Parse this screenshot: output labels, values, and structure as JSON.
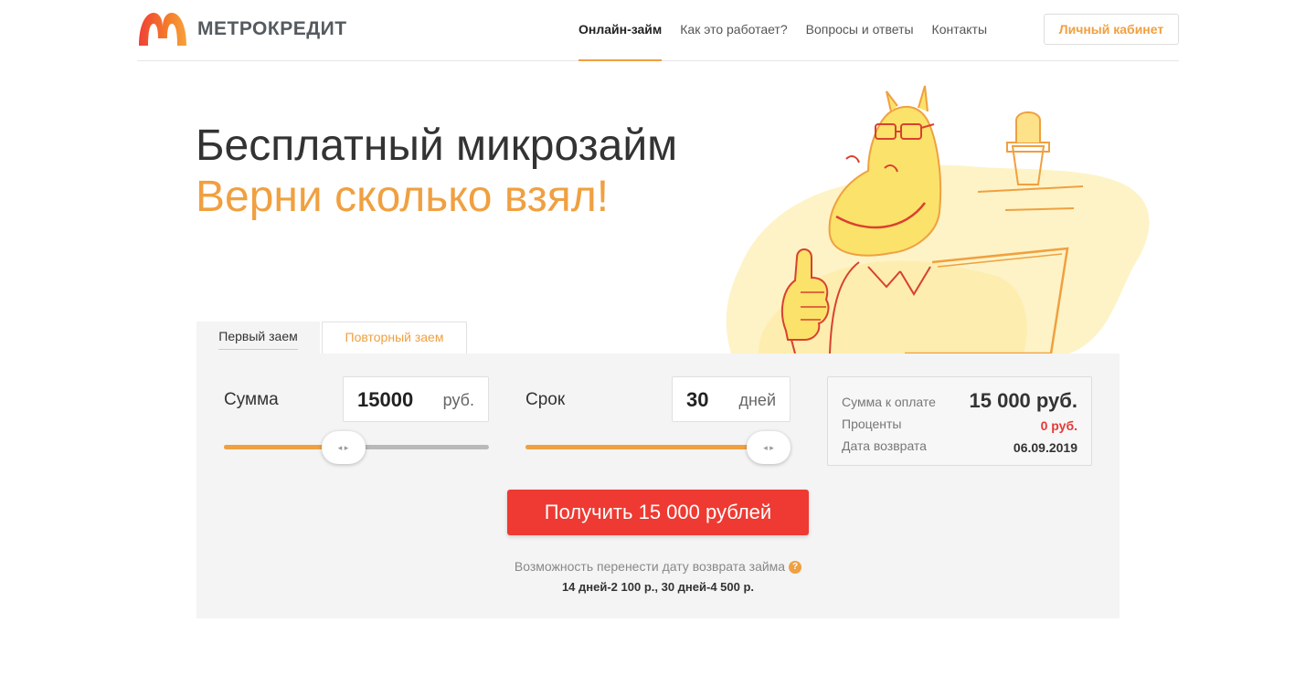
{
  "header": {
    "logo_text": "МЕТРОКРЕДИТ",
    "nav": [
      {
        "label": "Онлайн-займ",
        "active": true
      },
      {
        "label": "Как это работает?",
        "active": false
      },
      {
        "label": "Вопросы и ответы",
        "active": false
      },
      {
        "label": "Контакты",
        "active": false
      }
    ],
    "cabinet_label": "Личный кабинет"
  },
  "hero": {
    "title": "Бесплатный микрозайм",
    "subtitle": "Верни сколько взял!"
  },
  "tabs": [
    {
      "label": "Первый заем",
      "active": true
    },
    {
      "label": "Повторный заем",
      "active": false
    }
  ],
  "calculator": {
    "amount": {
      "label": "Сумма",
      "value": "15000",
      "unit": "руб.",
      "slider_fraction": 0.45
    },
    "term": {
      "label": "Срок",
      "value": "30",
      "unit": "дней",
      "slider_fraction": 1.0
    },
    "summary": {
      "total_label": "Сумма к оплате",
      "total_value": "15 000 руб.",
      "interest_label": "Проценты",
      "interest_value": "0 руб.",
      "return_label": "Дата возврата",
      "return_value": "06.09.2019"
    },
    "cta_label": "Получить 15 000 рублей",
    "note_line1": "Возможность перенести дату возврата займа",
    "note_help": "?",
    "note_line2": "14 дней-2 100 р., 30 дней-4 500 р.",
    "handle_glyph": "◂ ▸"
  },
  "colors": {
    "accent": "#f0a040",
    "cta": "#ee3a32",
    "panel": "#f4f4f4"
  }
}
